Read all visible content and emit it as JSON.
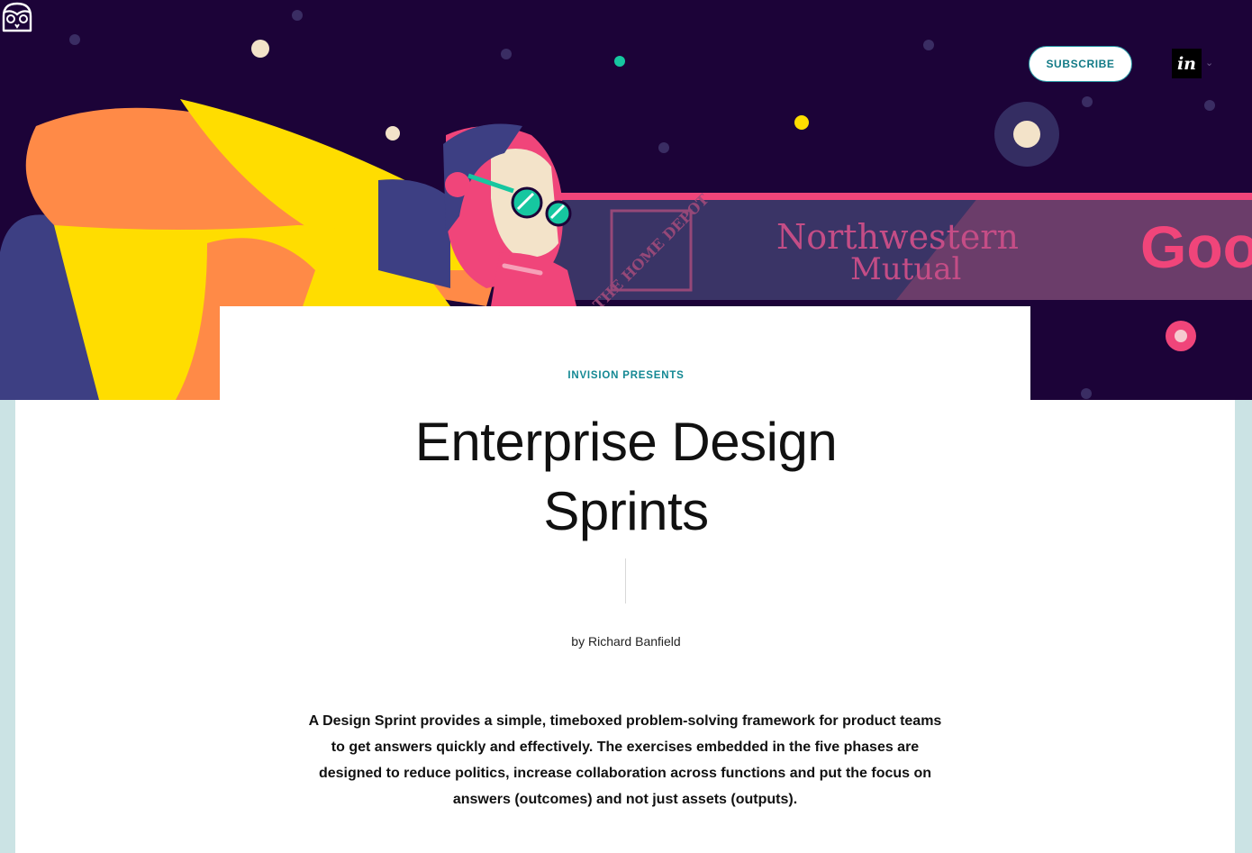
{
  "header": {
    "logo_icon": "owl-icon",
    "subscribe_label": "SUBSCRIBE",
    "invision_logo_text": "in",
    "caret_icon": "chevron-down-icon"
  },
  "hero": {
    "sponsor_logos": [
      "THE HOME DEPOT",
      "Northwestern Mutual",
      "Google"
    ],
    "colors": {
      "background": "#1c0338",
      "accent_pink": "#f0457a",
      "accent_orange": "#ff8a47",
      "accent_yellow": "#ffdd00",
      "accent_teal": "#16c7a0"
    }
  },
  "article": {
    "eyebrow": "INVISION PRESENTS",
    "title": "Enterprise Design Sprints",
    "byline": "by Richard Banfield",
    "intro": "A Design Sprint provides a simple, timeboxed problem-solving framework for product teams to get answers quickly and effectively. The exercises embedded in the five phases are designed to reduce politics, increase collaboration across functions and put the focus on answers (outcomes) and not just assets (outputs)."
  }
}
